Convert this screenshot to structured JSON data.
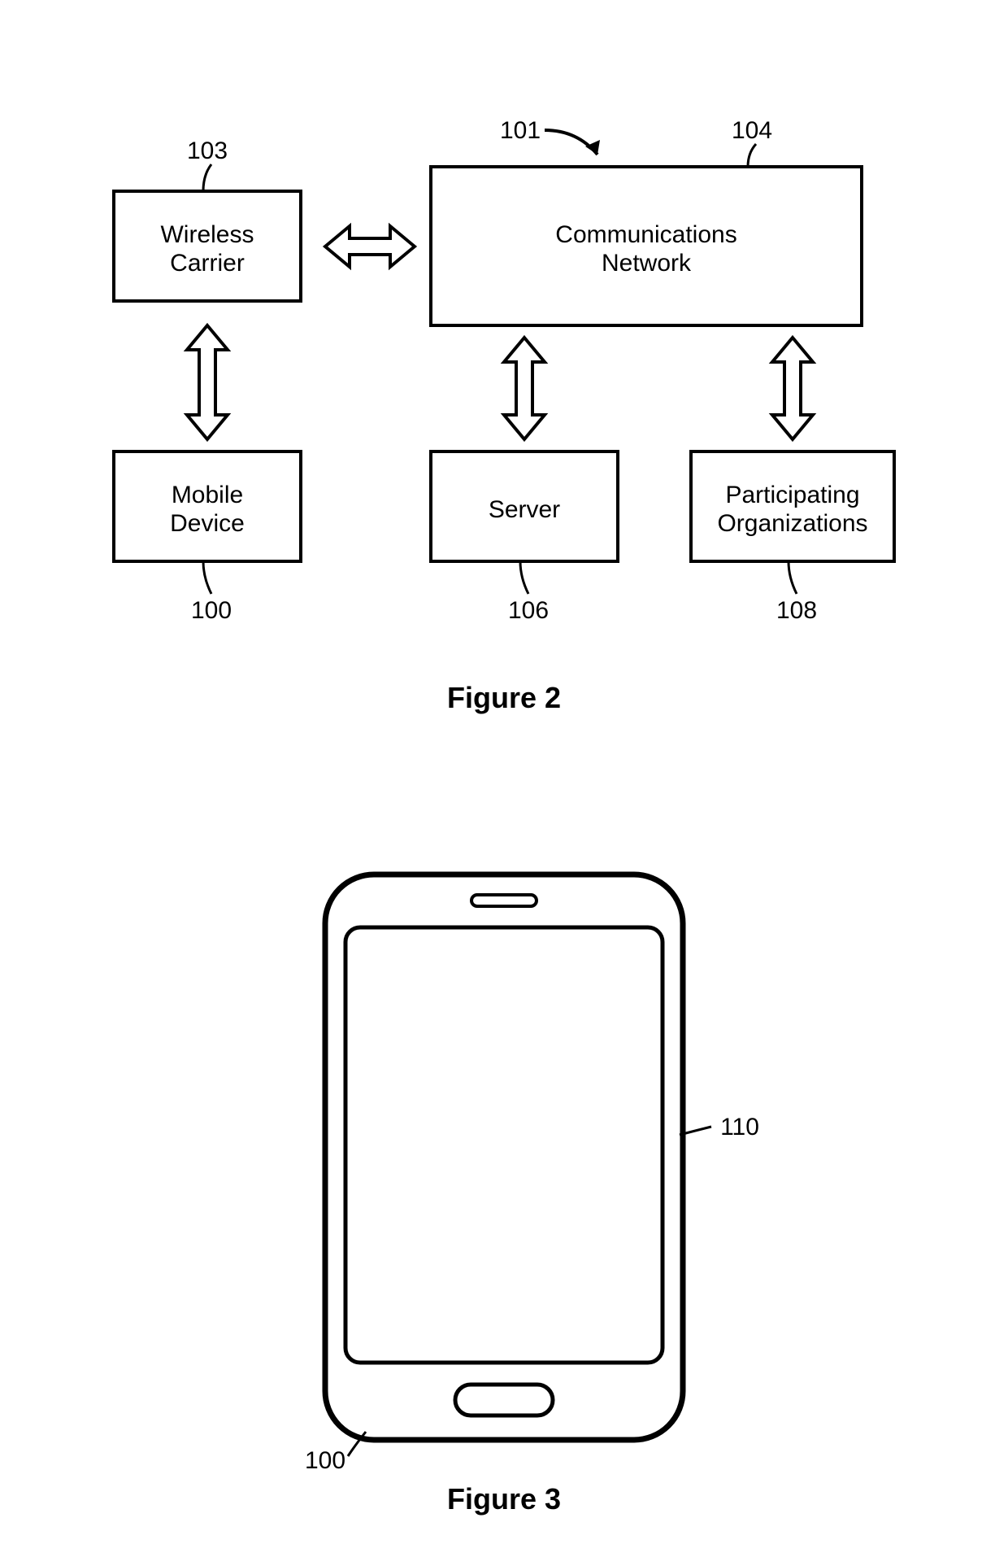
{
  "figure2": {
    "caption": "Figure 2",
    "system_ref": "101",
    "nodes": {
      "wireless_carrier": {
        "label_l1": "Wireless",
        "label_l2": "Carrier",
        "ref": "103"
      },
      "comm_network": {
        "label_l1": "Communications",
        "label_l2": "Network",
        "ref": "104"
      },
      "mobile_device": {
        "label_l1": "Mobile",
        "label_l2": "Device",
        "ref": "100"
      },
      "server": {
        "label": "Server",
        "ref": "106"
      },
      "participating": {
        "label_l1": "Participating",
        "label_l2": "Organizations",
        "ref": "108"
      }
    }
  },
  "figure3": {
    "caption": "Figure 3",
    "device_ref": "100",
    "screen_ref": "110"
  }
}
